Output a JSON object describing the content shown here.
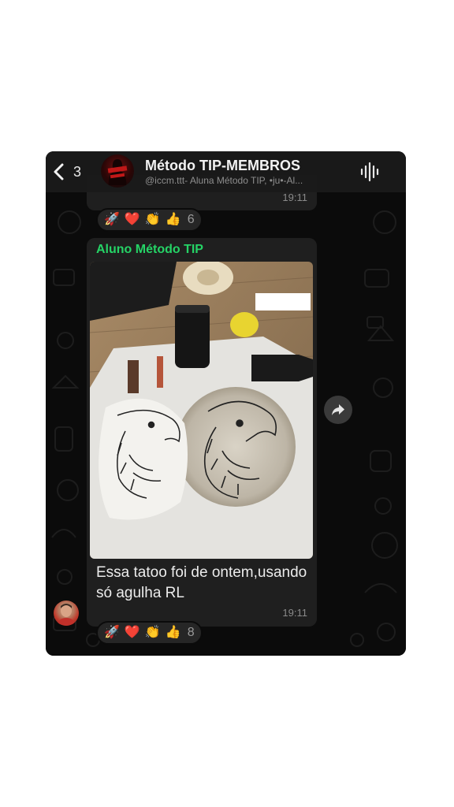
{
  "header": {
    "back_count": "3",
    "title": "Método TIP-MEMBROS",
    "subtitle": "@iccm.ttt- Aluna Método TIP, •ju•-Al..."
  },
  "messages": [
    {
      "time": "19:11",
      "reactions": [
        "🚀",
        "❤️",
        "👏",
        "👍"
      ],
      "reaction_count": "6"
    },
    {
      "sender": "Aluno Método TIP",
      "sender_color": "#25d366",
      "caption": "Essa tatoo foi de ontem,usando só agulha RL",
      "time": "19:11",
      "reactions": [
        "🚀",
        "❤️",
        "👏",
        "👍"
      ],
      "reaction_count": "8"
    }
  ],
  "icons": {
    "back": "chevron-left-icon",
    "audio": "waveform-icon",
    "forward": "share-arrow-icon"
  }
}
